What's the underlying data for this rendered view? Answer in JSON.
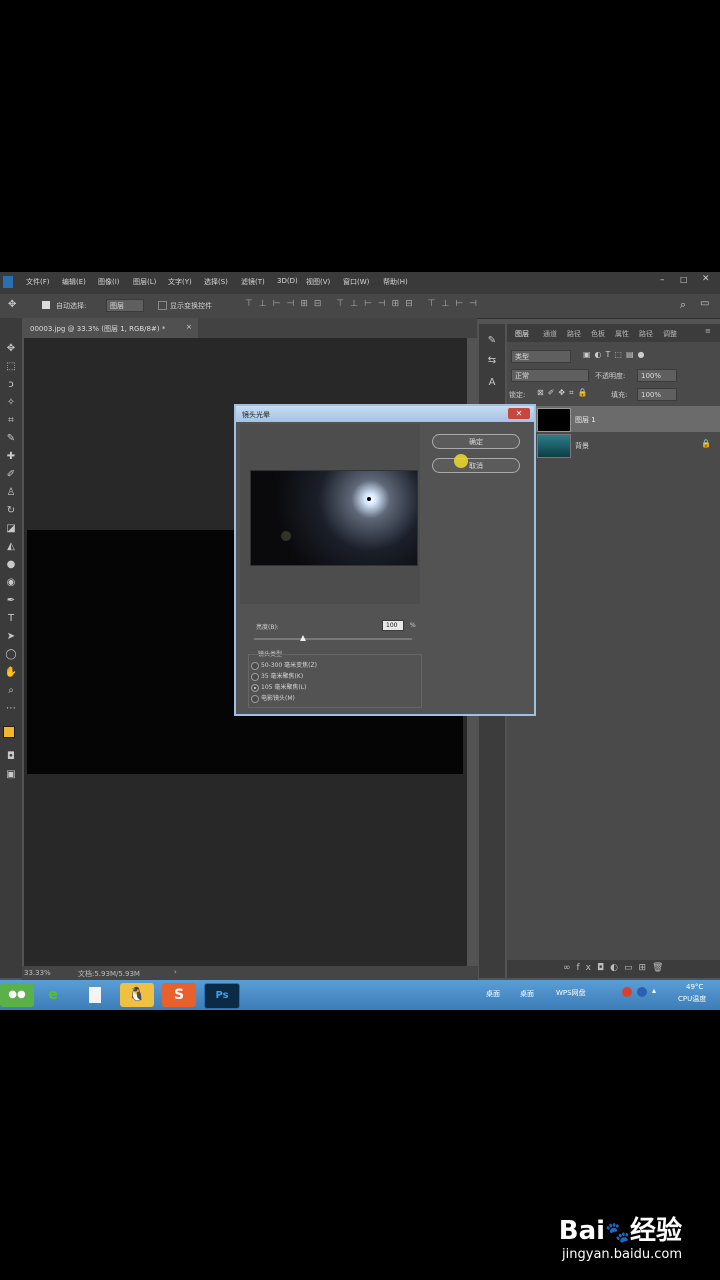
{
  "menu": [
    "文件(F)",
    "编辑(E)",
    "图像(I)",
    "图层(L)",
    "文字(Y)",
    "选择(S)",
    "滤镜(T)",
    "3D(D)",
    "视图(V)",
    "窗口(W)",
    "帮助(H)"
  ],
  "options": {
    "auto_select_label": "自动选择:",
    "auto_select_value": "图层",
    "transform_label": "显示变换控件"
  },
  "document_tab": {
    "title": "00003.jpg @ 33.3% (图层 1, RGB/8#) *",
    "close": "×"
  },
  "status": {
    "zoom": "33.33%",
    "doc_info": "文档:5.93M/5.93M",
    "arrow": "›"
  },
  "panel": {
    "tabs": [
      "图层",
      "通道",
      "路径",
      "色板",
      "属性",
      "路径",
      "调整"
    ],
    "kind_label": "类型",
    "blend_mode": "正常",
    "opacity_label": "不透明度:",
    "opacity_value": "100%",
    "lock_label": "锁定:",
    "fill_label": "填充:",
    "fill_value": "100%",
    "layers": [
      {
        "name": "图层 1"
      },
      {
        "name": "背景"
      }
    ]
  },
  "dialog": {
    "title": "镜头光晕",
    "ok_label": "确定",
    "cancel_label": "取消",
    "brightness_label": "亮度(B):",
    "brightness_value": "100",
    "brightness_unit": "%",
    "brightness_level": 1.0,
    "lens_group_label": "镜头类型",
    "lens_options": [
      "50-300 毫米变焦(Z)",
      "35 毫米聚焦(K)",
      "105 毫米聚焦(L)",
      "电影镜头(M)"
    ],
    "selected_option": 2
  },
  "taskbar": {
    "items": [
      "wechat-icon",
      "ie-icon",
      "file-icon",
      "qq-icon",
      "sogou-icon",
      "ps-icon"
    ],
    "ps_label": "Ps",
    "sogou_label": "S",
    "desktop_label": "桌面",
    "desktop2_label": "桌面",
    "wps_label": "WPS网盘",
    "temp": "49°C",
    "cpu_label": "CPU温度"
  },
  "watermark": {
    "logo": "Bai",
    "logo_cn": "经验",
    "url": "jingyan.baidu.com"
  },
  "colors": {
    "accent": "#9fc0e0",
    "foreground_swatch": "#f1b62b",
    "taskbar": "#4a8cc8"
  }
}
